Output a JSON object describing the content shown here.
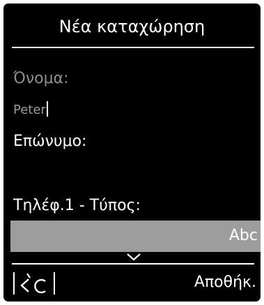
{
  "screen": {
    "title": "Νέα καταχώρηση"
  },
  "fields": {
    "first_name_label": "Όνομα:",
    "first_name_value": "Peter",
    "last_name_label": "Επώνυμο:",
    "last_name_value": "",
    "phone1_type_label": "Τηλέφ.1 - Τύπος:",
    "phone1_type_value": "Abc"
  },
  "softkeys": {
    "left_icon": "backspace-delete-icon",
    "right_label": "Αποθήκ."
  },
  "colors": {
    "background": "#000000",
    "text": "#ffffff",
    "dim_text": "#8f8f8f",
    "selection_bar": "#9d9d9d"
  }
}
